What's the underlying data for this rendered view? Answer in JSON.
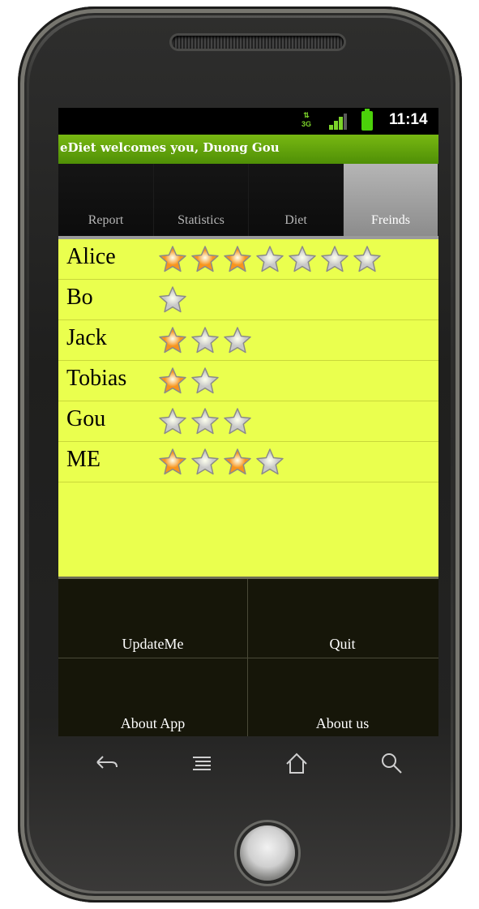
{
  "status_bar": {
    "network": "3G",
    "time": "11:14"
  },
  "app": {
    "title": "eDiet welcomes you, Duong Gou"
  },
  "tabs": [
    {
      "label": "Report",
      "selected": false
    },
    {
      "label": "Statistics",
      "selected": false
    },
    {
      "label": "Diet",
      "selected": false
    },
    {
      "label": "Freinds",
      "selected": true
    }
  ],
  "friends": [
    {
      "name": "Alice",
      "stars": [
        "on",
        "on",
        "on",
        "off",
        "off",
        "off",
        "off"
      ]
    },
    {
      "name": "Bo",
      "stars": [
        "off"
      ]
    },
    {
      "name": "Jack",
      "stars": [
        "on",
        "off",
        "off"
      ]
    },
    {
      "name": "Tobias",
      "stars": [
        "on",
        "off"
      ]
    },
    {
      "name": "Gou",
      "stars": [
        "off",
        "off",
        "off"
      ]
    },
    {
      "name": "ME",
      "stars": [
        "on",
        "off",
        "on",
        "off"
      ]
    }
  ],
  "buttons": {
    "update": "UpdateMe",
    "quit": "Quit",
    "about_app": "About App",
    "about_us": "About us"
  },
  "nav": {
    "back": "back-icon",
    "menu": "menu-icon",
    "home": "home-icon",
    "search": "search-icon"
  },
  "colors": {
    "title_bar": "#5a9a08",
    "list_background": "#eaff4e",
    "star_on": "#f7941d",
    "star_off": "#c8c8c8"
  }
}
